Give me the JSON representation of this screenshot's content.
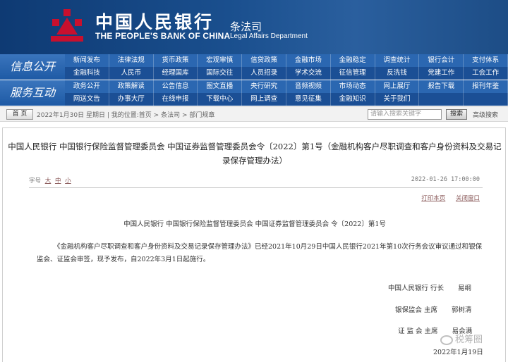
{
  "header": {
    "brand_cn": "中国人民银行",
    "brand_en": "THE PEOPLE'S BANK OF CHINA",
    "dept_cn": "条法司",
    "dept_en": "Legal Affairs Department",
    "logo_color": "#c8102e"
  },
  "nav": {
    "group1": {
      "label": "信息公开",
      "row1": [
        "新闻发布",
        "法律法规",
        "货币政策",
        "宏观审慎",
        "信贷政策",
        "金融市场",
        "金融稳定",
        "调查统计",
        "银行会计",
        "支付体系"
      ],
      "row2": [
        "金融科技",
        "人民币",
        "经理国库",
        "国际交往",
        "人员招录",
        "学术交流",
        "征信管理",
        "反洗钱",
        "党建工作",
        "工会工作"
      ]
    },
    "group2": {
      "label": "服务互动",
      "row1": [
        "政务公开",
        "政策解读",
        "公告信息",
        "图文直播",
        "央行研究",
        "音频视频",
        "市场动态",
        "网上展厅",
        "报告下载",
        "报刊年鉴"
      ],
      "row2": [
        "网送文告",
        "办事大厅",
        "在线申报",
        "下载中心",
        "网上调查",
        "意见征集",
        "金融知识",
        "关于我们",
        "",
        ""
      ]
    }
  },
  "status": {
    "home": "首 页",
    "date": "2022年1月30日 星期日",
    "location_label": "我的位置:首页",
    "crumb1": "条法司",
    "crumb2": "部门规章",
    "search_placeholder": "请输入搜索关键字",
    "search_button": "搜索",
    "advanced_search": "高级搜索"
  },
  "article": {
    "title": "中国人民银行 中国银行保险监督管理委员会 中国证券监督管理委员会令〔2022〕第1号（金融机构客户尽职调查和客户身份资料及交易记录保存管理办法）",
    "font_label": "字号",
    "font_large": "大",
    "font_medium": "中",
    "font_small": "小",
    "publish_time": "2022-01-26 17:00:00",
    "print_link": "打印本页",
    "close_link": "关闭窗口",
    "order_line": "中国人民银行 中国银行保险监督管理委员会 中国证券监督管理委员会 令〔2022〕第1号",
    "body": "《金融机构客户尽职调查和客户身份资料及交易记录保存管理办法》已经2021年10月29日中国人民银行2021年第10次行务会议审议通过和银保监会、证监会审签，现予发布，自2022年3月1日起施行。",
    "signatures": [
      {
        "org": "中国人民银行 行长",
        "name": "易纲"
      },
      {
        "org": "银保监会 主席",
        "name": "郭树清"
      },
      {
        "org": "证 监 会 主席",
        "name": "易会满"
      }
    ],
    "sign_date": "2022年1月19日"
  },
  "watermark": "税筹圈"
}
